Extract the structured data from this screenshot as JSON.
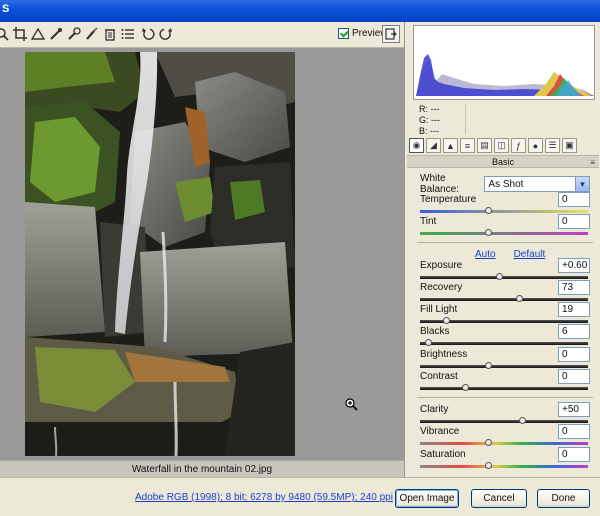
{
  "window": {
    "title_glyph": "S"
  },
  "toolbar": {
    "tools": [
      "zoom-icon",
      "hand-icon",
      "white-balance-icon",
      "color-sampler-icon",
      "crop-icon",
      "straighten-icon",
      "retouch-icon",
      "red-eye-icon",
      "preferences-icon",
      "rotate-left-icon",
      "rotate-right-icon"
    ],
    "preview_label": "Preview",
    "preview_checked": true
  },
  "canvas": {
    "filename": "Waterfall  in the mountain 02.jpg"
  },
  "histogram": {
    "r_label": "R:",
    "r_value": "---",
    "g_label": "G:",
    "g_value": "---",
    "b_label": "B:",
    "b_value": "---"
  },
  "panel": {
    "title": "Basic",
    "white_balance_label": "White Balance:",
    "white_balance_value": "As Shot",
    "auto_label": "Auto",
    "default_label": "Default",
    "sliders": [
      {
        "label": "Temperature",
        "value": "0",
        "pos": 0.5,
        "track": "temp"
      },
      {
        "label": "Tint",
        "value": "0",
        "pos": 0.5,
        "track": "tint"
      },
      {
        "label": "Exposure",
        "value": "+0.60",
        "pos": 0.58,
        "track": "dark"
      },
      {
        "label": "Recovery",
        "value": "73",
        "pos": 0.73,
        "track": "dark"
      },
      {
        "label": "Fill Light",
        "value": "19",
        "pos": 0.19,
        "track": "dark"
      },
      {
        "label": "Blacks",
        "value": "6",
        "pos": 0.06,
        "track": "dark"
      },
      {
        "label": "Brightness",
        "value": "0",
        "pos": 0.5,
        "track": "dark"
      },
      {
        "label": "Contrast",
        "value": "0",
        "pos": 0.33,
        "track": "dark"
      },
      {
        "label": "Clarity",
        "value": "+50",
        "pos": 0.75,
        "track": "dark"
      },
      {
        "label": "Vibrance",
        "value": "0",
        "pos": 0.5,
        "track": "sat"
      },
      {
        "label": "Saturation",
        "value": "0",
        "pos": 0.5,
        "track": "sat"
      }
    ]
  },
  "footer": {
    "info": "Adobe RGB (1998); 8 bit; 6278 by 9480 (59.5MP); 240 ppi",
    "open_label": "Open Image",
    "cancel_label": "Cancel",
    "done_label": "Done"
  },
  "colors": {
    "link": "#1a3fc9",
    "title_bar": "#0a4fd6",
    "canvas_bg": "#9a9a9a"
  }
}
